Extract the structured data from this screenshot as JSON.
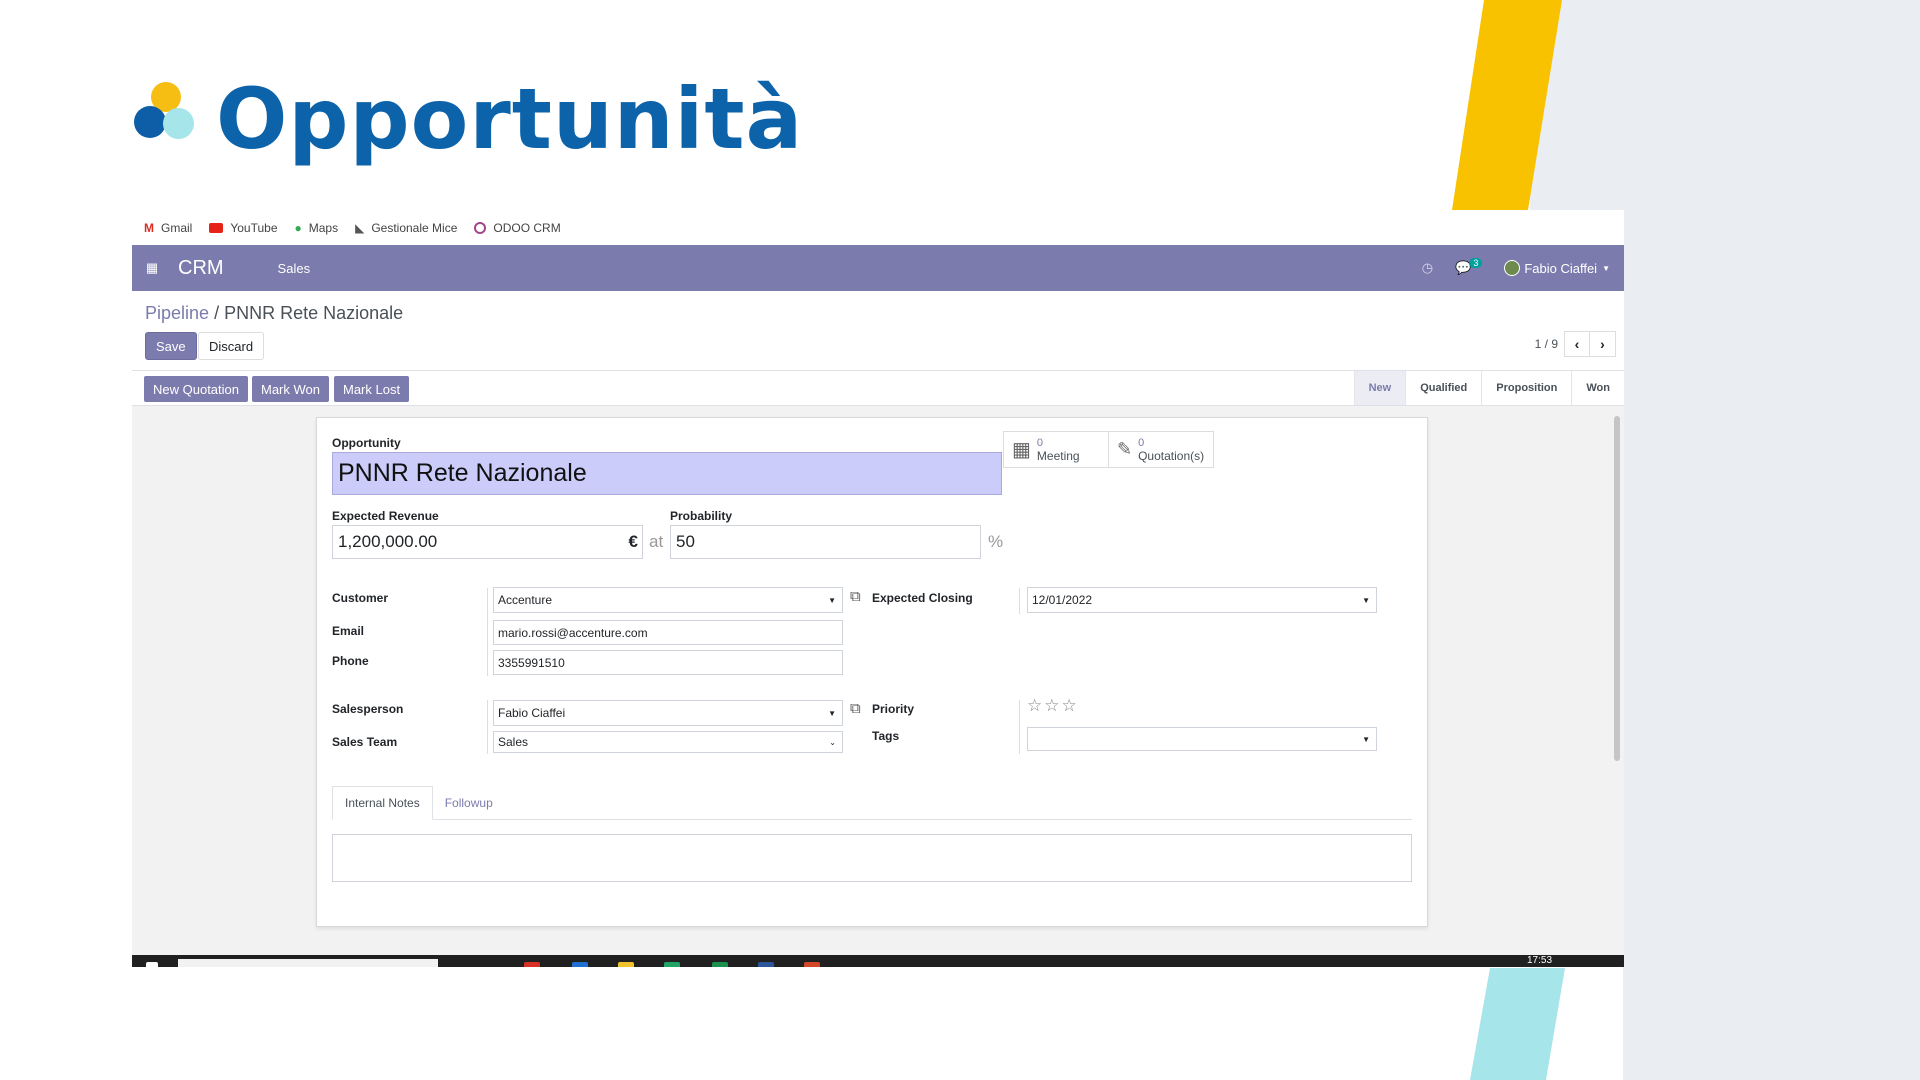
{
  "slide": {
    "title": "Opportunità",
    "colors": {
      "title": "#0c63aa",
      "accent_yellow": "#f8c200",
      "accent_teal": "#a6e5e9"
    }
  },
  "bookmarks": [
    {
      "label": "Gmail",
      "icon": "gmail-icon"
    },
    {
      "label": "YouTube",
      "icon": "youtube-icon"
    },
    {
      "label": "Maps",
      "icon": "maps-pin-icon"
    },
    {
      "label": "Gestionale Mice",
      "icon": "gestionale-icon"
    },
    {
      "label": "ODOO CRM",
      "icon": "odoo-icon"
    }
  ],
  "navbar": {
    "brand": "CRM",
    "menu": "Sales",
    "chat_badge": "3",
    "user": "Fabio Ciaffei",
    "color": "#7c7bad"
  },
  "breadcrumb": {
    "parent": "Pipeline",
    "separator": "/",
    "current": "PNNR Rete Nazionale"
  },
  "buttons": {
    "save": "Save",
    "discard": "Discard",
    "new_quotation": "New Quotation",
    "mark_won": "Mark Won",
    "mark_lost": "Mark Lost"
  },
  "pager": {
    "value": "1 / 9"
  },
  "stages": [
    {
      "label": "New",
      "active": true
    },
    {
      "label": "Qualified",
      "active": false
    },
    {
      "label": "Proposition",
      "active": false
    },
    {
      "label": "Won",
      "active": false
    }
  ],
  "smart_buttons": {
    "meeting": {
      "count": "0",
      "label": "Meeting"
    },
    "quotations": {
      "count": "0",
      "label": "Quotation(s)"
    }
  },
  "form": {
    "opportunity_label": "Opportunity",
    "opportunity_value": "PNNR Rete Nazionale",
    "expected_revenue_label": "Expected Revenue",
    "expected_revenue_value": "1,200,000.00",
    "currency": "€",
    "at": "at",
    "probability_label": "Probability",
    "probability_value": "50",
    "percent": "%",
    "customer_label": "Customer",
    "customer_value": "Accenture",
    "email_label": "Email",
    "email_value": "mario.rossi@accenture.com",
    "phone_label": "Phone",
    "phone_value": "3355991510",
    "expected_closing_label": "Expected Closing",
    "expected_closing_value": "12/01/2022",
    "salesperson_label": "Salesperson",
    "salesperson_value": "Fabio Ciaffei",
    "sales_team_label": "Sales Team",
    "sales_team_value": "Sales",
    "priority_label": "Priority",
    "priority_stars": "☆☆☆",
    "tags_label": "Tags",
    "tags_value": ""
  },
  "tabs": {
    "internal_notes": "Internal Notes",
    "followup": "Followup"
  },
  "taskbar": {
    "time": "17:53"
  }
}
